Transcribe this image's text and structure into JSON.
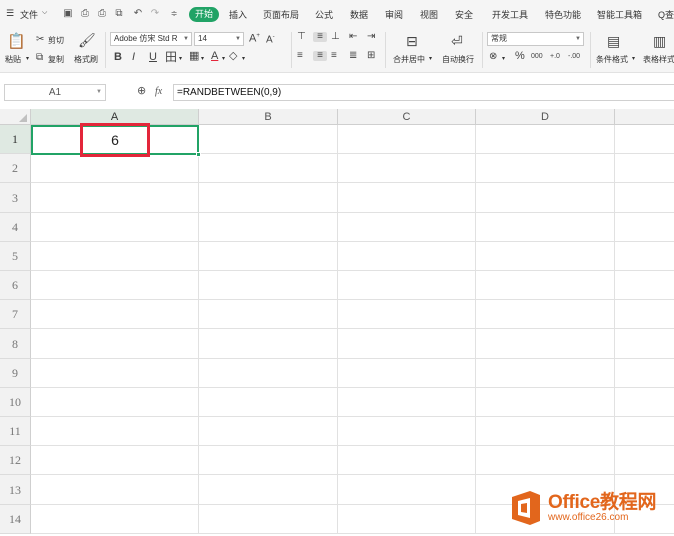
{
  "menubar": {
    "menu_label": "文件",
    "tabs": [
      "开始",
      "插入",
      "页面布局",
      "公式",
      "数据",
      "审阅",
      "视图",
      "安全",
      "开发工具",
      "特色功能",
      "智能工具箱"
    ],
    "active_tab": "开始",
    "search_label": "Q查"
  },
  "ribbon": {
    "paste_label": "粘贴",
    "cut_label": "剪切",
    "copy_label": "复制",
    "format_painter_label": "格式刷",
    "font_name": "Adobe 仿宋 Std R",
    "font_size": "14",
    "bold": "B",
    "italic": "I",
    "underline": "U",
    "merge_center_label": "合并居中",
    "auto_wrap_label": "自动换行",
    "number_format": "常规",
    "percent": "%",
    "thousands": "000",
    "inc_decimal": "+.0",
    "dec_decimal": "-.00",
    "conditional_format_label": "条件格式",
    "table_style_label": "表格样式"
  },
  "formula_bar": {
    "name_box": "A1",
    "fx_label": "fx",
    "formula": "=RANDBETWEEN(0,9)"
  },
  "sheet": {
    "columns": [
      "A",
      "B",
      "C",
      "D"
    ],
    "rows": [
      "1",
      "2",
      "3",
      "4",
      "5",
      "6",
      "7",
      "8",
      "9",
      "10",
      "11",
      "12",
      "13",
      "14"
    ],
    "a1_value": "6",
    "selected_cell": "A1"
  },
  "watermark": {
    "title": "Office教程网",
    "url": "www.office26.com"
  },
  "colors": {
    "accent": "#21a366",
    "highlight": "#e3263a",
    "watermark": "#e2661c"
  }
}
